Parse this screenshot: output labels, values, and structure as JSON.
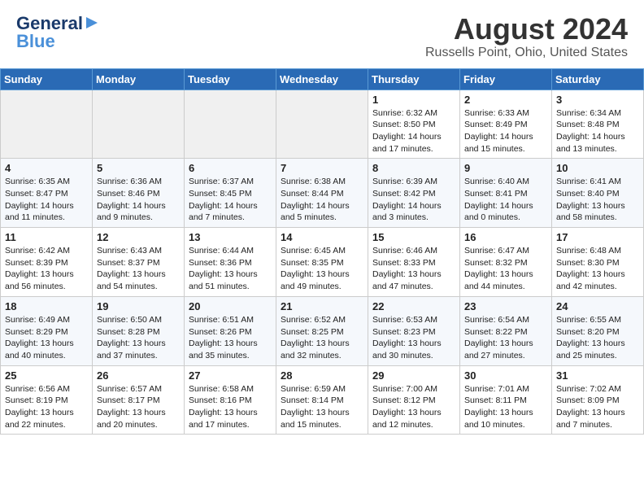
{
  "header": {
    "logo_general": "General",
    "logo_blue": "Blue",
    "title": "August 2024",
    "subtitle": "Russells Point, Ohio, United States"
  },
  "days_of_week": [
    "Sunday",
    "Monday",
    "Tuesday",
    "Wednesday",
    "Thursday",
    "Friday",
    "Saturday"
  ],
  "weeks": [
    [
      {
        "day": "",
        "info": ""
      },
      {
        "day": "",
        "info": ""
      },
      {
        "day": "",
        "info": ""
      },
      {
        "day": "",
        "info": ""
      },
      {
        "day": "1",
        "info": "Sunrise: 6:32 AM\nSunset: 8:50 PM\nDaylight: 14 hours\nand 17 minutes."
      },
      {
        "day": "2",
        "info": "Sunrise: 6:33 AM\nSunset: 8:49 PM\nDaylight: 14 hours\nand 15 minutes."
      },
      {
        "day": "3",
        "info": "Sunrise: 6:34 AM\nSunset: 8:48 PM\nDaylight: 14 hours\nand 13 minutes."
      }
    ],
    [
      {
        "day": "4",
        "info": "Sunrise: 6:35 AM\nSunset: 8:47 PM\nDaylight: 14 hours\nand 11 minutes."
      },
      {
        "day": "5",
        "info": "Sunrise: 6:36 AM\nSunset: 8:46 PM\nDaylight: 14 hours\nand 9 minutes."
      },
      {
        "day": "6",
        "info": "Sunrise: 6:37 AM\nSunset: 8:45 PM\nDaylight: 14 hours\nand 7 minutes."
      },
      {
        "day": "7",
        "info": "Sunrise: 6:38 AM\nSunset: 8:44 PM\nDaylight: 14 hours\nand 5 minutes."
      },
      {
        "day": "8",
        "info": "Sunrise: 6:39 AM\nSunset: 8:42 PM\nDaylight: 14 hours\nand 3 minutes."
      },
      {
        "day": "9",
        "info": "Sunrise: 6:40 AM\nSunset: 8:41 PM\nDaylight: 14 hours\nand 0 minutes."
      },
      {
        "day": "10",
        "info": "Sunrise: 6:41 AM\nSunset: 8:40 PM\nDaylight: 13 hours\nand 58 minutes."
      }
    ],
    [
      {
        "day": "11",
        "info": "Sunrise: 6:42 AM\nSunset: 8:39 PM\nDaylight: 13 hours\nand 56 minutes."
      },
      {
        "day": "12",
        "info": "Sunrise: 6:43 AM\nSunset: 8:37 PM\nDaylight: 13 hours\nand 54 minutes."
      },
      {
        "day": "13",
        "info": "Sunrise: 6:44 AM\nSunset: 8:36 PM\nDaylight: 13 hours\nand 51 minutes."
      },
      {
        "day": "14",
        "info": "Sunrise: 6:45 AM\nSunset: 8:35 PM\nDaylight: 13 hours\nand 49 minutes."
      },
      {
        "day": "15",
        "info": "Sunrise: 6:46 AM\nSunset: 8:33 PM\nDaylight: 13 hours\nand 47 minutes."
      },
      {
        "day": "16",
        "info": "Sunrise: 6:47 AM\nSunset: 8:32 PM\nDaylight: 13 hours\nand 44 minutes."
      },
      {
        "day": "17",
        "info": "Sunrise: 6:48 AM\nSunset: 8:30 PM\nDaylight: 13 hours\nand 42 minutes."
      }
    ],
    [
      {
        "day": "18",
        "info": "Sunrise: 6:49 AM\nSunset: 8:29 PM\nDaylight: 13 hours\nand 40 minutes."
      },
      {
        "day": "19",
        "info": "Sunrise: 6:50 AM\nSunset: 8:28 PM\nDaylight: 13 hours\nand 37 minutes."
      },
      {
        "day": "20",
        "info": "Sunrise: 6:51 AM\nSunset: 8:26 PM\nDaylight: 13 hours\nand 35 minutes."
      },
      {
        "day": "21",
        "info": "Sunrise: 6:52 AM\nSunset: 8:25 PM\nDaylight: 13 hours\nand 32 minutes."
      },
      {
        "day": "22",
        "info": "Sunrise: 6:53 AM\nSunset: 8:23 PM\nDaylight: 13 hours\nand 30 minutes."
      },
      {
        "day": "23",
        "info": "Sunrise: 6:54 AM\nSunset: 8:22 PM\nDaylight: 13 hours\nand 27 minutes."
      },
      {
        "day": "24",
        "info": "Sunrise: 6:55 AM\nSunset: 8:20 PM\nDaylight: 13 hours\nand 25 minutes."
      }
    ],
    [
      {
        "day": "25",
        "info": "Sunrise: 6:56 AM\nSunset: 8:19 PM\nDaylight: 13 hours\nand 22 minutes."
      },
      {
        "day": "26",
        "info": "Sunrise: 6:57 AM\nSunset: 8:17 PM\nDaylight: 13 hours\nand 20 minutes."
      },
      {
        "day": "27",
        "info": "Sunrise: 6:58 AM\nSunset: 8:16 PM\nDaylight: 13 hours\nand 17 minutes."
      },
      {
        "day": "28",
        "info": "Sunrise: 6:59 AM\nSunset: 8:14 PM\nDaylight: 13 hours\nand 15 minutes."
      },
      {
        "day": "29",
        "info": "Sunrise: 7:00 AM\nSunset: 8:12 PM\nDaylight: 13 hours\nand 12 minutes."
      },
      {
        "day": "30",
        "info": "Sunrise: 7:01 AM\nSunset: 8:11 PM\nDaylight: 13 hours\nand 10 minutes."
      },
      {
        "day": "31",
        "info": "Sunrise: 7:02 AM\nSunset: 8:09 PM\nDaylight: 13 hours\nand 7 minutes."
      }
    ]
  ]
}
